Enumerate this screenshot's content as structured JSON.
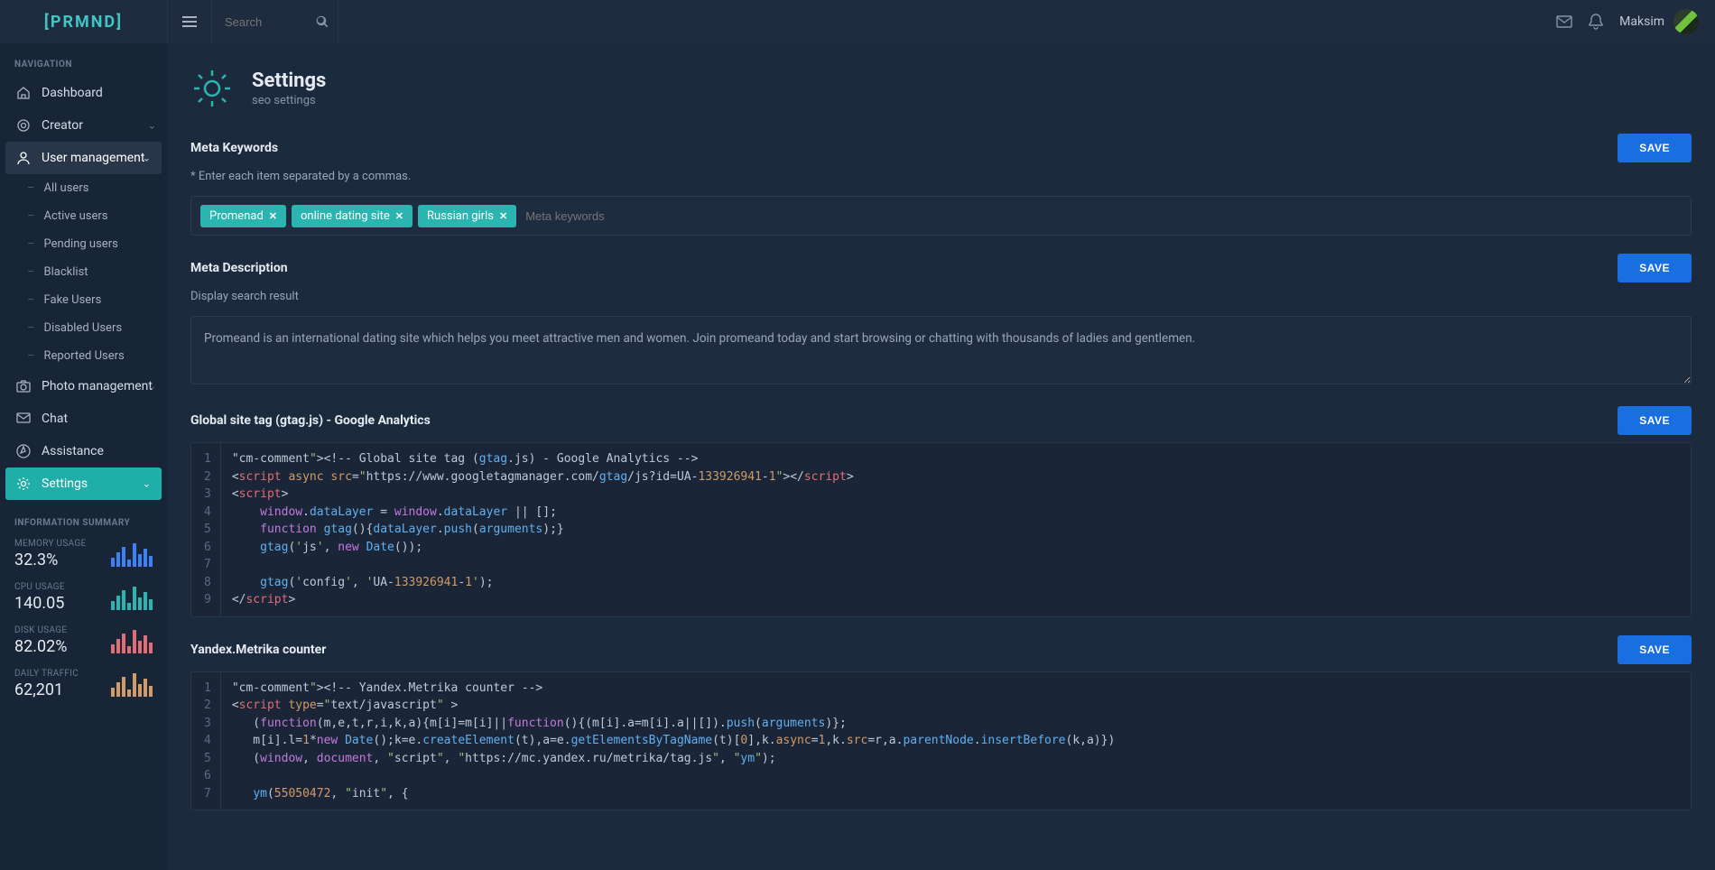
{
  "brand": "[PRMND]",
  "search_placeholder": "Search",
  "user_name": "Maksim",
  "nav_title": "NAVIGATION",
  "nav": {
    "dashboard": "Dashboard",
    "creator": "Creator",
    "user_mgmt": "User management",
    "um_sub": [
      "All users",
      "Active users",
      "Pending users",
      "Blacklist",
      "Fake Users",
      "Disabled Users",
      "Reported Users"
    ],
    "photo_mgmt": "Photo management",
    "chat": "Chat",
    "assistance": "Assistance",
    "settings": "Settings"
  },
  "info_title": "INFORMATION SUMMARY",
  "info": {
    "mem_label": "MEMORY USAGE",
    "mem_value": "32.3%",
    "cpu_label": "CPU USAGE",
    "cpu_value": "140.05",
    "disk_label": "DISK USAGE",
    "disk_value": "82.02%",
    "traffic_label": "DAILY TRAFFIC",
    "traffic_value": "62,201"
  },
  "page": {
    "title": "Settings",
    "subtitle": "seo settings"
  },
  "sections": {
    "meta_kw": {
      "title": "Meta Keywords",
      "hint": "* Enter each item separated by a commas.",
      "tags": [
        "Promenad",
        "online dating site",
        "Russian girls"
      ],
      "placeholder": "Meta keywords",
      "save": "SAVE"
    },
    "meta_desc": {
      "title": "Meta Description",
      "hint": "Display search result",
      "value": "Promeand is an international dating site which helps you meet attractive men and women. Join promeand today and start browsing or chatting with thousands of ladies and gentlemen.",
      "save": "SAVE"
    },
    "gtag": {
      "title": "Global site tag (gtag.js) - Google Analytics",
      "save": "SAVE",
      "lines": [
        "<!-- Global site tag (gtag.js) - Google Analytics -->",
        "<script async src=\"https://www.googletagmanager.com/gtag/js?id=UA-133926941-1\"></script>",
        "<script>",
        "    window.dataLayer = window.dataLayer || [];",
        "    function gtag(){dataLayer.push(arguments);}",
        "    gtag('js', new Date());",
        "",
        "    gtag('config', 'UA-133926941-1');",
        "</script>"
      ]
    },
    "yandex": {
      "title": "Yandex.Metrika counter",
      "save": "SAVE",
      "lines": [
        "<!-- Yandex.Metrika counter -->",
        "<script type=\"text/javascript\" >",
        "   (function(m,e,t,r,i,k,a){m[i]=m[i]||function(){(m[i].a=m[i].a||[]).push(arguments)};",
        "   m[i].l=1*new Date();k=e.createElement(t),a=e.getElementsByTagName(t)[0],k.async=1,k.src=r,a.parentNode.insertBefore(k,a)})",
        "   (window, document, \"script\", \"https://mc.yandex.ru/metrika/tag.js\", \"ym\");",
        "",
        "   ym(55050472, \"init\", {"
      ]
    }
  },
  "colors": {
    "bars_mem": "#3b82f6",
    "bars_cpu": "#2ab5b0",
    "bars_disk": "#e06c75",
    "bars_traffic": "#d19a66"
  }
}
